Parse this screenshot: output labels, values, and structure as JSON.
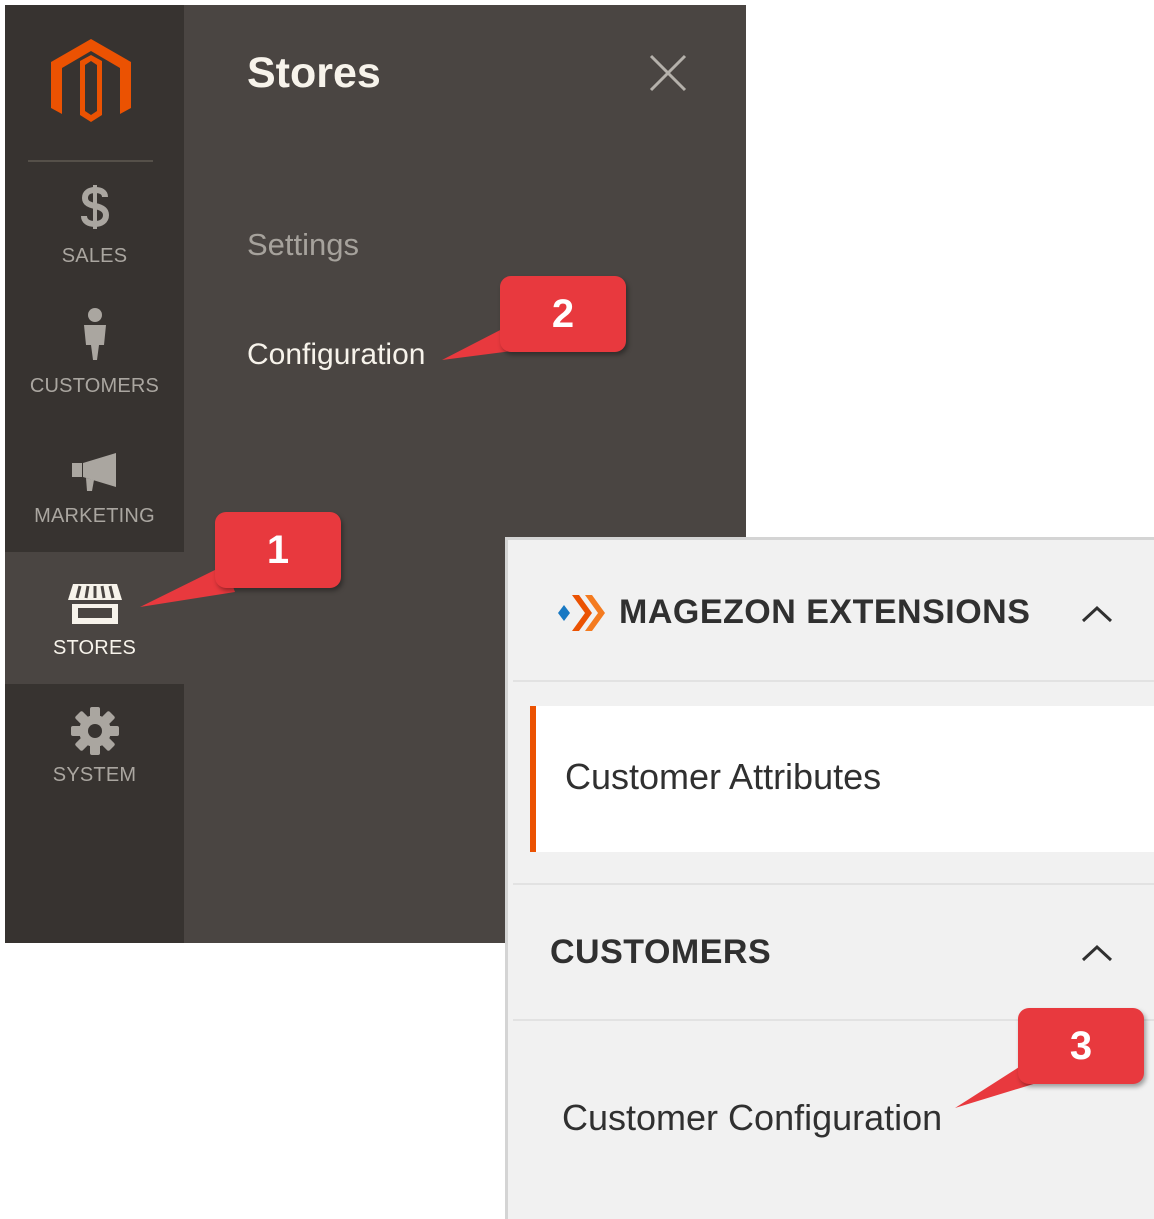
{
  "sidebar": {
    "logo_icon": "magento-logo-icon",
    "items": [
      {
        "label": "SALES",
        "icon": "dollar-icon"
      },
      {
        "label": "CUSTOMERS",
        "icon": "person-icon"
      },
      {
        "label": "MARKETING",
        "icon": "megaphone-icon"
      },
      {
        "label": "STORES",
        "icon": "storefront-icon",
        "active": true
      },
      {
        "label": "SYSTEM",
        "icon": "gear-icon"
      }
    ]
  },
  "flyout": {
    "title": "Stores",
    "close_icon": "close-icon",
    "section_heading": "Settings",
    "link": "Configuration"
  },
  "config_panel": {
    "sections": [
      {
        "title": "MAGEZON EXTENSIONS",
        "icon": "magezon-logo-icon",
        "expanded": true,
        "items": [
          "Customer Attributes"
        ]
      },
      {
        "title": "CUSTOMERS",
        "expanded": true,
        "items": [
          "Customer Configuration"
        ]
      }
    ]
  },
  "callouts": [
    "1",
    "2",
    "3"
  ],
  "colors": {
    "sidebar_bg": "#373330",
    "flyout_bg": "#4a4542",
    "accent_orange": "#eb5202",
    "callout_red": "#e8393e"
  }
}
